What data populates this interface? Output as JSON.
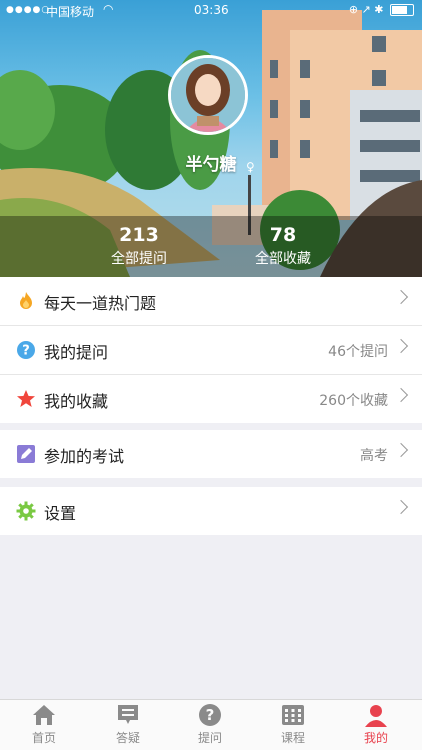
{
  "status_bar": {
    "signal": "●●●●○",
    "carrier": "中国移动",
    "wifi": "wifi-icon",
    "time": "03:36",
    "right_icons": "⊕ ↗ ✱"
  },
  "profile": {
    "nickname": "半勺糖",
    "gender_icon": "female-icon",
    "stats": {
      "questions_count": "213",
      "questions_label": "全部提问",
      "favorites_count": "78",
      "favorites_label": "全部收藏"
    }
  },
  "menu": {
    "group1": [
      {
        "label": "每天一道热门题",
        "value": "",
        "icon": "flame-icon",
        "color": "#f5a623"
      },
      {
        "label": "我的提问",
        "value": "46个提问",
        "icon": "question-icon",
        "color": "#4aa8e8"
      },
      {
        "label": "我的收藏",
        "value": "260个收藏",
        "icon": "star-icon",
        "color": "#f0463c"
      }
    ],
    "group2": [
      {
        "label": "参加的考试",
        "value": "高考",
        "icon": "pencil-icon",
        "color": "#8a7bd6"
      }
    ],
    "group3": [
      {
        "label": "设置",
        "value": "",
        "icon": "gear-icon",
        "color": "#7ac943"
      }
    ]
  },
  "tabs": [
    {
      "label": "首页",
      "icon": "home-icon",
      "active": false
    },
    {
      "label": "答疑",
      "icon": "answer-icon",
      "active": false
    },
    {
      "label": "提问",
      "icon": "ask-icon",
      "active": false
    },
    {
      "label": "课程",
      "icon": "course-icon",
      "active": false
    },
    {
      "label": "我的",
      "icon": "profile-icon",
      "active": true
    }
  ],
  "colors": {
    "accent": "#e8424e",
    "tab_inactive": "#8a8a8a",
    "background": "#efeff4"
  }
}
